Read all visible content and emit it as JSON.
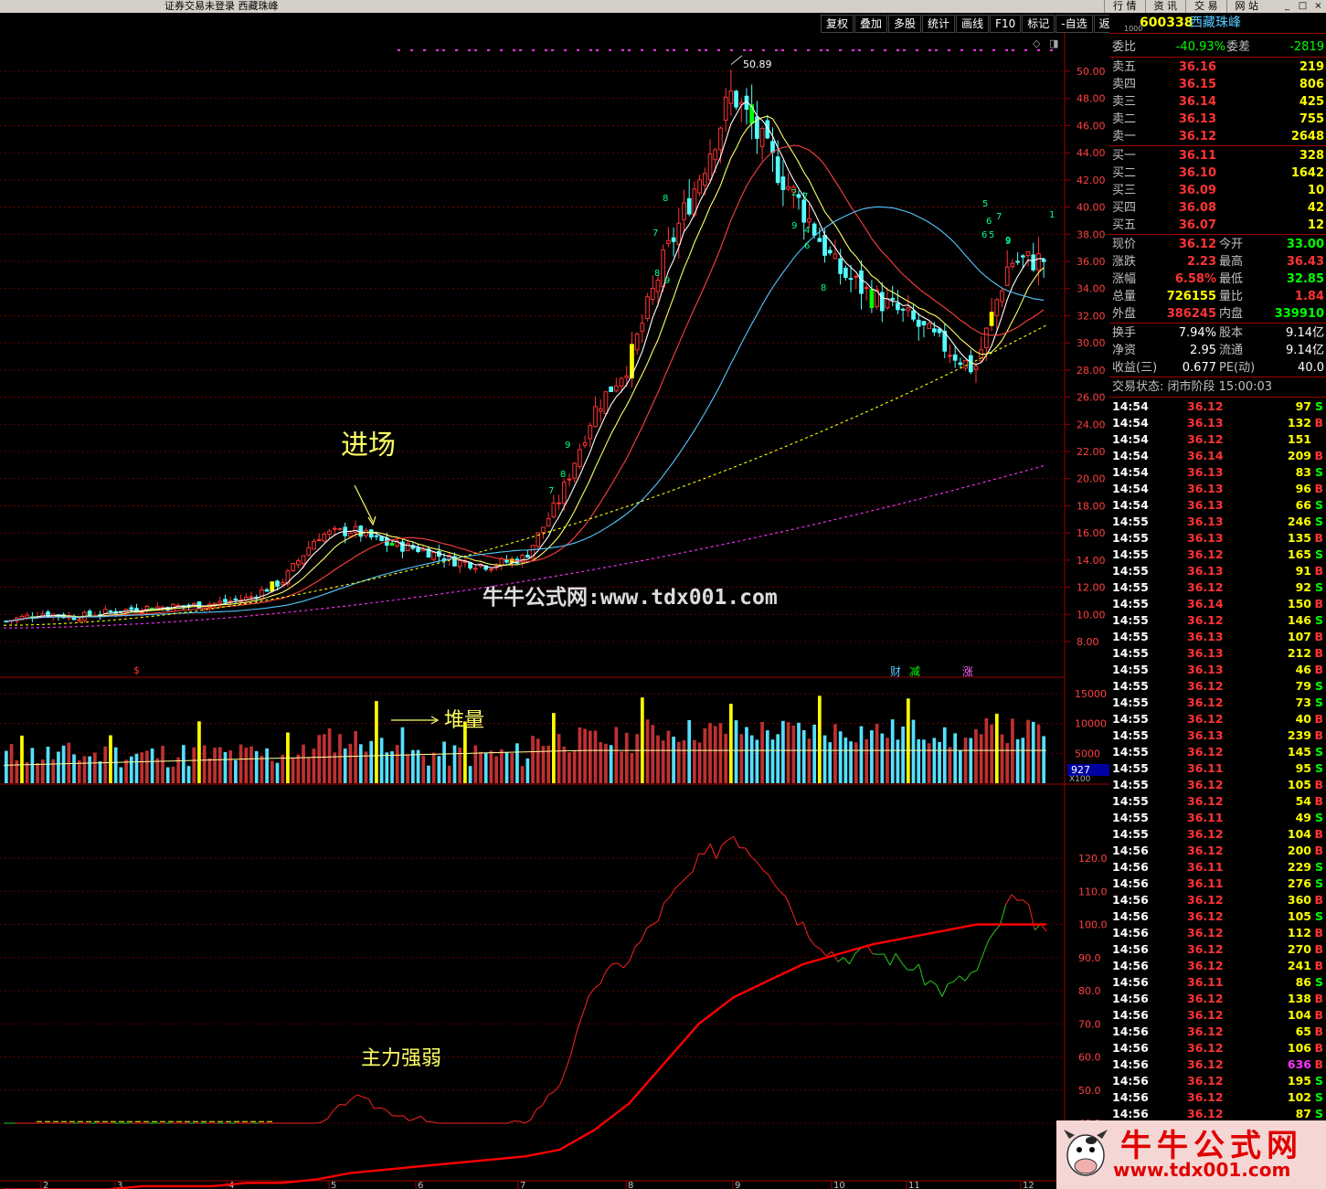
{
  "window": {
    "title": "证券交易未登录   西藏珠峰",
    "menu": [
      "行 情",
      "资 讯",
      "交 易",
      "网 站"
    ],
    "win_buttons": [
      "_",
      "□",
      "×"
    ]
  },
  "toolbar": [
    "复权",
    "叠加",
    "多股",
    "统计",
    "画线",
    "F10",
    "标记",
    "-自选",
    "返回"
  ],
  "chart": {
    "price_axis": [
      "50.00",
      "48.00",
      "46.00",
      "44.00",
      "42.00",
      "40.00",
      "38.00",
      "36.00",
      "34.00",
      "32.00",
      "30.00",
      "28.00",
      "26.00",
      "24.00",
      "22.00",
      "20.00",
      "18.00",
      "16.00",
      "14.00",
      "12.00",
      "10.00",
      "8.00"
    ],
    "volume_axis": [
      "15000",
      "10000",
      "5000"
    ],
    "volume_marker": "927",
    "volume_unit": "X100",
    "strength_axis": [
      "120.0",
      "110.0",
      "100.0",
      "90.0",
      "80.0",
      "70.0",
      "60.0",
      "50.0",
      "40.0"
    ],
    "month_labels": [
      "2",
      "3",
      "4",
      "5",
      "6",
      "7",
      "8",
      "9",
      "10",
      "11",
      "12"
    ],
    "peak_label": "50.89",
    "event_tags": [
      "$",
      "财",
      "减",
      "涨"
    ],
    "watermark": "牛牛公式网:www.tdx001.com",
    "annotations": {
      "entry": "进场",
      "volume": "堆量",
      "strength": "主力强弱"
    },
    "wave_numbers": [
      "7",
      "8",
      "9",
      "9",
      "8",
      "7",
      "8",
      "9",
      "7",
      "6",
      "2",
      "4",
      "5",
      "6",
      "8",
      "9",
      "5",
      "6",
      "7",
      "9",
      "1"
    ],
    "colors": {
      "up": "#ff3333",
      "down": "#54ffff",
      "ma5": "#ffffff",
      "ma10": "#ffff66",
      "ma20": "#ff4040",
      "ma60": "#54c8ff",
      "ma120": "#ffff00",
      "ma250": "#ff33ff",
      "grid": "#800000",
      "strength_line": "#ff2020",
      "strength_ma": "#ff0000"
    }
  },
  "chart_data": [
    {
      "type": "line",
      "title": "",
      "series": [
        {
          "name": "",
          "x": [
            0,
            10,
            20,
            30,
            40,
            50,
            60,
            70,
            80,
            90,
            100,
            110,
            120,
            130,
            140,
            150,
            160,
            170,
            180,
            190,
            200,
            210,
            220,
            230,
            240,
            250,
            260,
            270,
            280,
            290,
            300
          ],
          "values": [
            9.5,
            10.1,
            9.8,
            10.2,
            10.5,
            10.6,
            10.8,
            11.2,
            12.5,
            15.8,
            16.2,
            15.2,
            14.8,
            13.9,
            13.6,
            14.2,
            18.5,
            25.0,
            28.5,
            36.0,
            42.0,
            48.5,
            44.0,
            40.0,
            35.5,
            33.5,
            32.0,
            30.0,
            28.0,
            36.0,
            36.12
          ]
        }
      ],
      "ylim": [
        8,
        51
      ]
    },
    {
      "type": "line",
      "title": "",
      "series": [
        {
          "name": "",
          "values": [
            20,
            21,
            20,
            20,
            21,
            21,
            22,
            22,
            24,
            38,
            48,
            44,
            41,
            38,
            39,
            40,
            52,
            82,
            90,
            105,
            118,
            128,
            118,
            100,
            90,
            92,
            88,
            80,
            86,
            108,
            98
          ]
        },
        {
          "name": "",
          "values": [
            20,
            20,
            20,
            20,
            21,
            21,
            21,
            22,
            22,
            23,
            25,
            26,
            27,
            28,
            29,
            30,
            32,
            38,
            46,
            58,
            70,
            78,
            83,
            88,
            91,
            94,
            96,
            98,
            100,
            100,
            100
          ]
        }
      ],
      "ylim": [
        40,
        130
      ]
    }
  ],
  "panel": {
    "code": "600338",
    "name": "西藏珠峰",
    "small_tag": "1000",
    "webi": {
      "label": "委比",
      "value": "-40.93%",
      "label2": "委差",
      "value2": "-2819"
    },
    "asks": [
      {
        "label": "卖五",
        "price": "36.16",
        "vol": "219"
      },
      {
        "label": "卖四",
        "price": "36.15",
        "vol": "806"
      },
      {
        "label": "卖三",
        "price": "36.14",
        "vol": "425"
      },
      {
        "label": "卖二",
        "price": "36.13",
        "vol": "755"
      },
      {
        "label": "卖一",
        "price": "36.12",
        "vol": "2648"
      }
    ],
    "bids": [
      {
        "label": "买一",
        "price": "36.11",
        "vol": "328"
      },
      {
        "label": "买二",
        "price": "36.10",
        "vol": "1642"
      },
      {
        "label": "买三",
        "price": "36.09",
        "vol": "10"
      },
      {
        "label": "买四",
        "price": "36.08",
        "vol": "42"
      },
      {
        "label": "买五",
        "price": "36.07",
        "vol": "12"
      }
    ],
    "stats1": [
      {
        "l1": "现价",
        "v1": "36.12",
        "l2": "今开",
        "v2": "33.00",
        "c1": "red",
        "c2": "grn"
      },
      {
        "l1": "涨跌",
        "v1": "2.23",
        "l2": "最高",
        "v2": "36.43",
        "c1": "red",
        "c2": "red"
      },
      {
        "l1": "涨幅",
        "v1": "6.58%",
        "l2": "最低",
        "v2": "32.85",
        "c1": "red",
        "c2": "grn"
      },
      {
        "l1": "总量",
        "v1": "726155",
        "l2": "量比",
        "v2": "1.84",
        "c1": "yel",
        "c2": "red"
      },
      {
        "l1": "外盘",
        "v1": "386245",
        "l2": "内盘",
        "v2": "339910",
        "c1": "red",
        "c2": "grn"
      }
    ],
    "stats2": [
      {
        "l1": "换手",
        "v1": "7.94%",
        "l2": "股本",
        "v2": "9.14亿"
      },
      {
        "l1": "净资",
        "v1": "2.95",
        "l2": "流通",
        "v2": "9.14亿"
      },
      {
        "l1": "收益(三)",
        "v1": "0.677",
        "l2": "PE(动)",
        "v2": "40.0"
      }
    ],
    "status": "交易状态: 闭市阶段 15:00:03",
    "ticks": [
      [
        "14:54",
        "36.12",
        "97",
        "S"
      ],
      [
        "14:54",
        "36.13",
        "132",
        "B"
      ],
      [
        "14:54",
        "36.12",
        "151",
        ""
      ],
      [
        "14:54",
        "36.14",
        "209",
        "B"
      ],
      [
        "14:54",
        "36.13",
        "83",
        "S"
      ],
      [
        "14:54",
        "36.13",
        "96",
        "B"
      ],
      [
        "14:54",
        "36.13",
        "66",
        "S"
      ],
      [
        "14:55",
        "36.13",
        "246",
        "S"
      ],
      [
        "14:55",
        "36.13",
        "135",
        "B"
      ],
      [
        "14:55",
        "36.12",
        "165",
        "S"
      ],
      [
        "14:55",
        "36.13",
        "91",
        "B"
      ],
      [
        "14:55",
        "36.12",
        "92",
        "S"
      ],
      [
        "14:55",
        "36.14",
        "150",
        "B"
      ],
      [
        "14:55",
        "36.12",
        "146",
        "S"
      ],
      [
        "14:55",
        "36.13",
        "107",
        "B"
      ],
      [
        "14:55",
        "36.13",
        "212",
        "B"
      ],
      [
        "14:55",
        "36.13",
        "46",
        "B"
      ],
      [
        "14:55",
        "36.12",
        "79",
        "S"
      ],
      [
        "14:55",
        "36.12",
        "73",
        "S"
      ],
      [
        "14:55",
        "36.12",
        "40",
        "B"
      ],
      [
        "14:55",
        "36.13",
        "239",
        "B"
      ],
      [
        "14:55",
        "36.12",
        "145",
        "S"
      ],
      [
        "14:55",
        "36.11",
        "95",
        "S"
      ],
      [
        "14:55",
        "36.12",
        "105",
        "B"
      ],
      [
        "14:55",
        "36.12",
        "54",
        "B"
      ],
      [
        "14:55",
        "36.11",
        "49",
        "S"
      ],
      [
        "14:55",
        "36.12",
        "104",
        "B"
      ],
      [
        "14:56",
        "36.12",
        "200",
        "B"
      ],
      [
        "14:56",
        "36.11",
        "229",
        "S"
      ],
      [
        "14:56",
        "36.11",
        "276",
        "S"
      ],
      [
        "14:56",
        "36.12",
        "360",
        "B"
      ],
      [
        "14:56",
        "36.12",
        "105",
        "S"
      ],
      [
        "14:56",
        "36.12",
        "112",
        "B"
      ],
      [
        "14:56",
        "36.12",
        "270",
        "B"
      ],
      [
        "14:56",
        "36.12",
        "241",
        "B"
      ],
      [
        "14:56",
        "36.11",
        "86",
        "S"
      ],
      [
        "14:56",
        "36.12",
        "138",
        "B"
      ],
      [
        "14:56",
        "36.12",
        "104",
        "B"
      ],
      [
        "14:56",
        "36.12",
        "65",
        "B"
      ],
      [
        "14:56",
        "36.12",
        "106",
        "B"
      ],
      [
        "14:56",
        "36.12",
        "636",
        "B"
      ],
      [
        "14:56",
        "36.12",
        "195",
        "S"
      ],
      [
        "14:56",
        "36.12",
        "102",
        "S"
      ],
      [
        "14:56",
        "36.12",
        "87",
        "S"
      ]
    ]
  },
  "logo": {
    "big": "牛牛公式网",
    "small": "www.tdx001.com"
  }
}
